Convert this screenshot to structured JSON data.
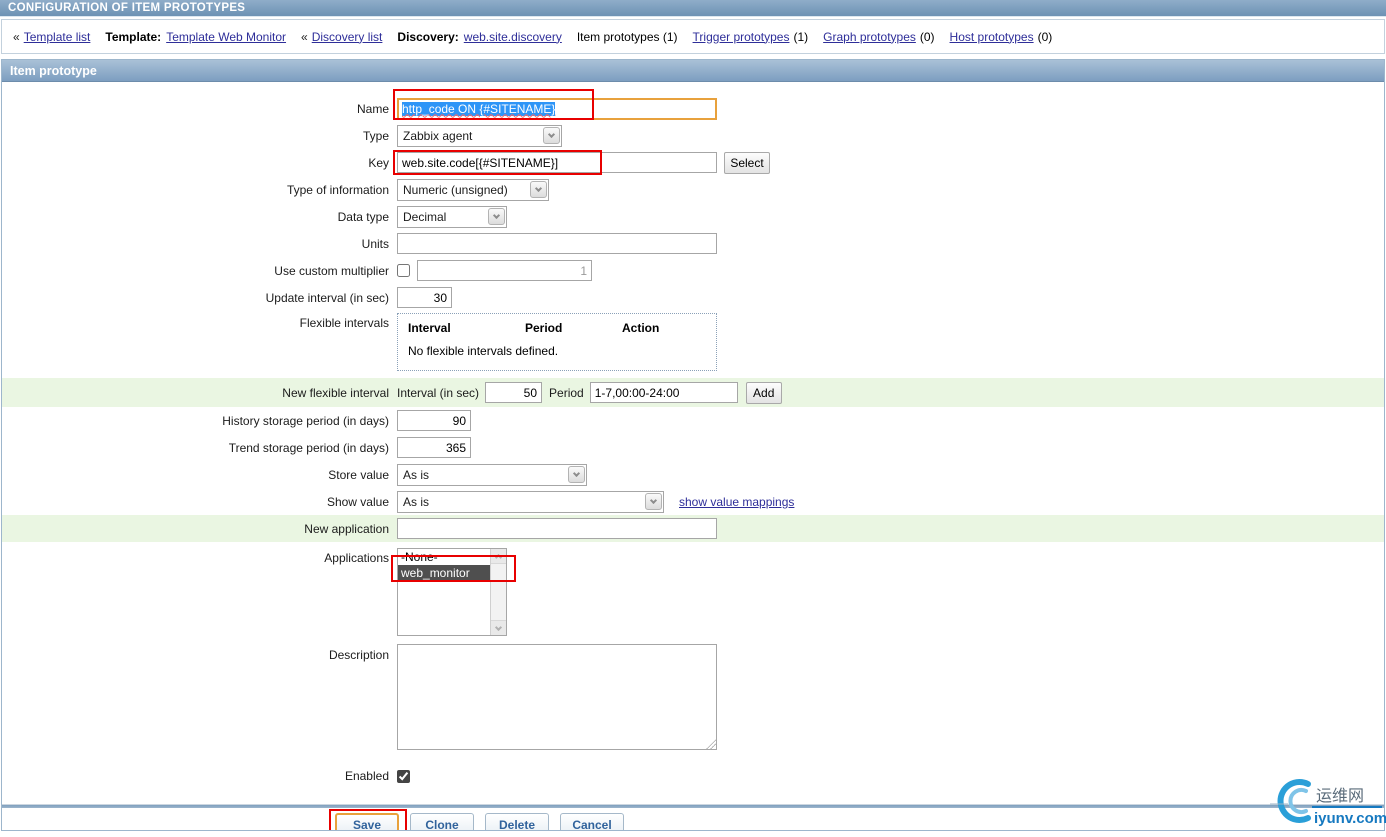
{
  "title_bar": {
    "text": "CONFIGURATION OF ITEM PROTOTYPES"
  },
  "breadcrumb": {
    "back_symbol": "«",
    "template_list": "Template list",
    "template_label": "Template:",
    "template_value": "Template Web Monitor",
    "discovery_list": "Discovery list",
    "discovery_label": "Discovery:",
    "discovery_value": "web.site.discovery",
    "item_prototypes": "Item prototypes (1)",
    "trigger_prototypes": "Trigger prototypes",
    "trigger_count": "(1)",
    "graph_prototypes": "Graph prototypes",
    "graph_count": "(0)",
    "host_prototypes": "Host prototypes",
    "host_count": "(0)"
  },
  "form": {
    "header": "Item prototype",
    "fields": {
      "name": {
        "label": "Name",
        "value": "http_code ON {#SITENAME}"
      },
      "type": {
        "label": "Type",
        "value": "Zabbix agent"
      },
      "key": {
        "label": "Key",
        "value": "web.site.code[{#SITENAME}]",
        "button": "Select"
      },
      "type_of_information": {
        "label": "Type of information",
        "value": "Numeric (unsigned)"
      },
      "data_type": {
        "label": "Data type",
        "value": "Decimal"
      },
      "units": {
        "label": "Units",
        "value": ""
      },
      "use_custom_multiplier": {
        "label": "Use custom multiplier",
        "checked": false,
        "value": "1"
      },
      "update_interval": {
        "label": "Update interval (in sec)",
        "value": "30"
      },
      "flexible_intervals": {
        "label": "Flexible intervals",
        "columns": [
          "Interval",
          "Period",
          "Action"
        ],
        "empty_text": "No flexible intervals defined."
      },
      "new_flexible_interval": {
        "label": "New flexible interval",
        "interval_label": "Interval (in sec)",
        "interval_value": "50",
        "period_label": "Period",
        "period_value": "1-7,00:00-24:00",
        "add_button": "Add"
      },
      "history": {
        "label": "History storage period (in days)",
        "value": "90"
      },
      "trend": {
        "label": "Trend storage period (in days)",
        "value": "365"
      },
      "store_value": {
        "label": "Store value",
        "value": "As is"
      },
      "show_value": {
        "label": "Show value",
        "value": "As is",
        "link": "show value mappings"
      },
      "new_application": {
        "label": "New application",
        "value": ""
      },
      "applications": {
        "label": "Applications",
        "options": [
          {
            "label": "-None-",
            "selected": false
          },
          {
            "label": "web_monitor",
            "selected": true
          }
        ]
      },
      "description": {
        "label": "Description",
        "value": ""
      },
      "enabled": {
        "label": "Enabled",
        "checked": true
      }
    },
    "footer_buttons": {
      "save": "Save",
      "clone": "Clone",
      "delete": "Delete",
      "cancel": "Cancel"
    }
  },
  "watermark": {
    "line1": "运维网",
    "line2": "iyunv.com"
  },
  "colors": {
    "header_gradient_top": "#a9c1d7",
    "header_gradient_bottom": "#7d9ec0",
    "green_row": "#eaf6e2",
    "annotation_red": "#e80000",
    "focus_orange": "#e8a13c",
    "link": "#2e2e99",
    "selection_blue": "#2e95f7",
    "listbox_selected_bg": "#4f4f4f",
    "footer_button_text": "#31639c"
  }
}
